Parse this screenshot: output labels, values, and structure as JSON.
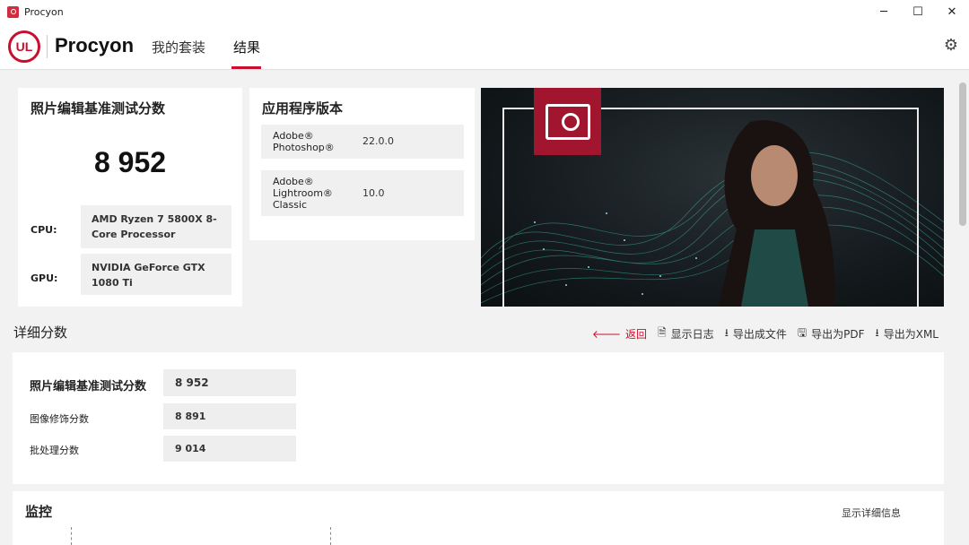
{
  "window": {
    "title": "Procyon",
    "minimize": "─",
    "maximize": "☐",
    "close": "✕"
  },
  "header": {
    "logo_text": "UL",
    "brand": "Procyon",
    "tabs": [
      {
        "label": "我的套装"
      },
      {
        "label": "结果",
        "active": true
      }
    ]
  },
  "score_card": {
    "title": "照片编辑基准测试分数",
    "score": "8 952",
    "cpu_label": "CPU:",
    "cpu_value": "AMD Ryzen 7 5800X 8-Core Processor",
    "gpu_label": "GPU:",
    "gpu_value": "NVIDIA GeForce GTX 1080 Ti"
  },
  "versions_card": {
    "title": "应用程序版本",
    "apps": [
      {
        "name": "Adobe® Photoshop®",
        "version": "22.0.0"
      },
      {
        "name": "Adobe® Lightroom® Classic",
        "version": "10.0"
      }
    ]
  },
  "details": {
    "title": "详细分数",
    "actions": [
      {
        "label": "返回",
        "icon": "arrow-left-icon"
      },
      {
        "label": "显示日志",
        "icon": "document-icon"
      },
      {
        "label": "导出成文件",
        "icon": "download-icon"
      },
      {
        "label": "导出为PDF",
        "icon": "save-icon"
      },
      {
        "label": "导出为XML",
        "icon": "download-icon"
      }
    ],
    "rows": [
      {
        "label": "照片编辑基准测试分数",
        "value": "8 952"
      },
      {
        "label": "图像修饰分数",
        "value": "8 891"
      },
      {
        "label": "批处理分数",
        "value": "9 014"
      }
    ]
  },
  "monitor": {
    "title": "监控",
    "link": "显示详细信息"
  },
  "colors": {
    "accent": "#c8102e",
    "badge": "#a1152e"
  }
}
